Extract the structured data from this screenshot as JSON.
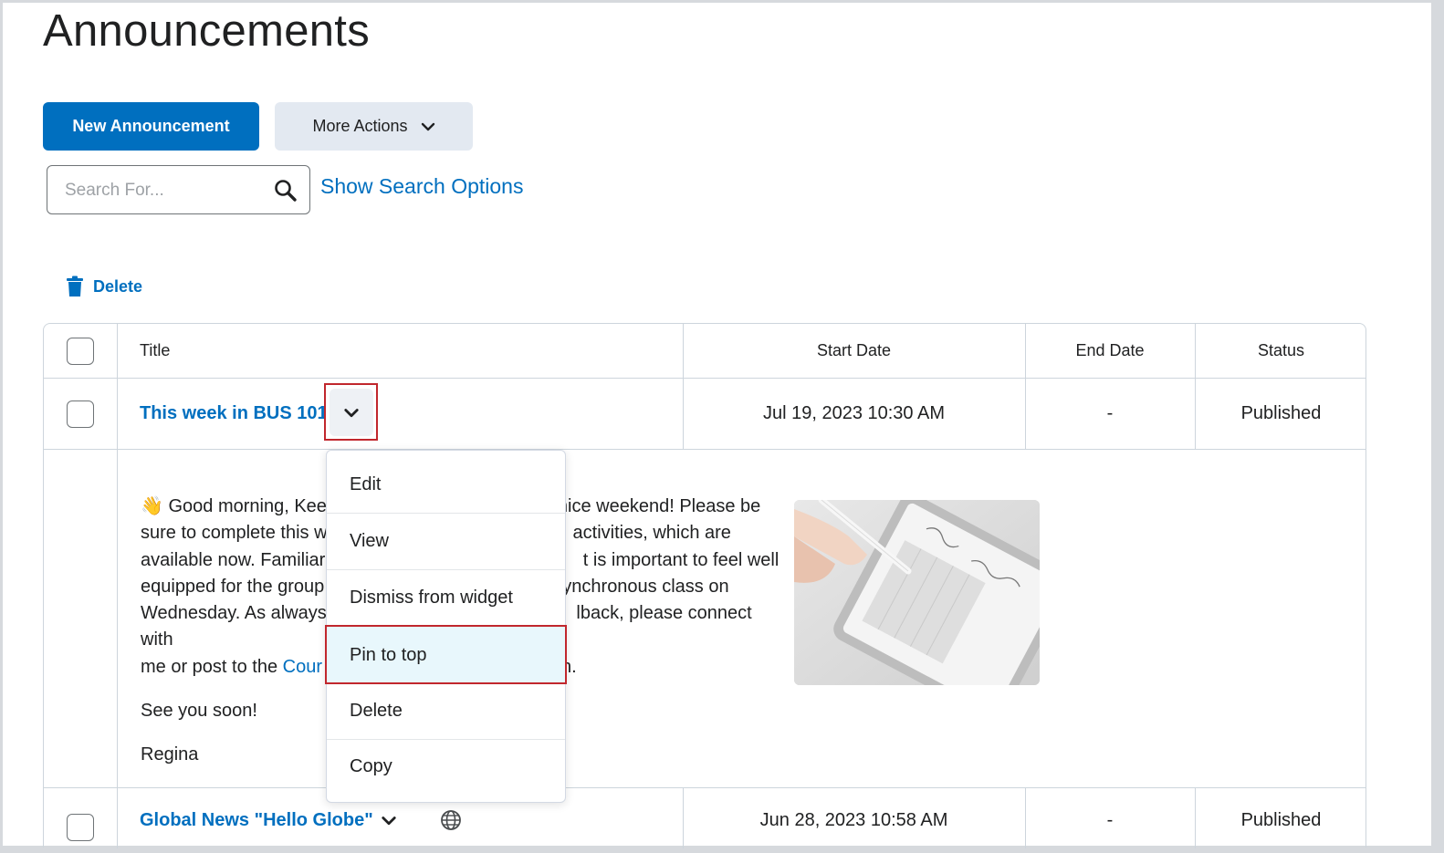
{
  "page": {
    "title": "Announcements"
  },
  "toolbar": {
    "new_label": "New Announcement",
    "more_label": "More Actions"
  },
  "search": {
    "placeholder": "Search For...",
    "value": "",
    "options_link": "Show Search Options"
  },
  "bulk": {
    "delete_label": "Delete"
  },
  "table": {
    "headers": {
      "title": "Title",
      "start": "Start Date",
      "end": "End Date",
      "status": "Status"
    },
    "rows": [
      {
        "title": "This week in BUS 101",
        "start": "Jul 19, 2023 10:30 AM",
        "end": "-",
        "status": "Published"
      },
      {
        "title": "Global News \"Hello Globe\"",
        "start": "Jun 28, 2023 10:58 AM",
        "end": "-",
        "status": "Published"
      }
    ],
    "detail": {
      "l1a": "Good morning, Kee",
      "l1b": "nice weekend! Please be",
      "l2a": "sure to complete this w",
      "l2b": "activities, which are",
      "l3a": "available now. Familiari",
      "l3b": "t is important to feel well",
      "l4a": "equipped for the group",
      "l4b": "ynchronous class on",
      "l5a": "Wednesday. As always,",
      "l5b": "lback, please connect with",
      "l6a": "me or post to the ",
      "l6link": "Cour",
      "l6b": "n.",
      "p2": "See you soon!",
      "p3": "Regina"
    }
  },
  "menu": {
    "items": [
      "Edit",
      "View",
      "Dismiss from widget",
      "Pin to top",
      "Delete",
      "Copy"
    ]
  },
  "colors": {
    "accent": "#006fbf",
    "highlight": "#c1272d"
  }
}
